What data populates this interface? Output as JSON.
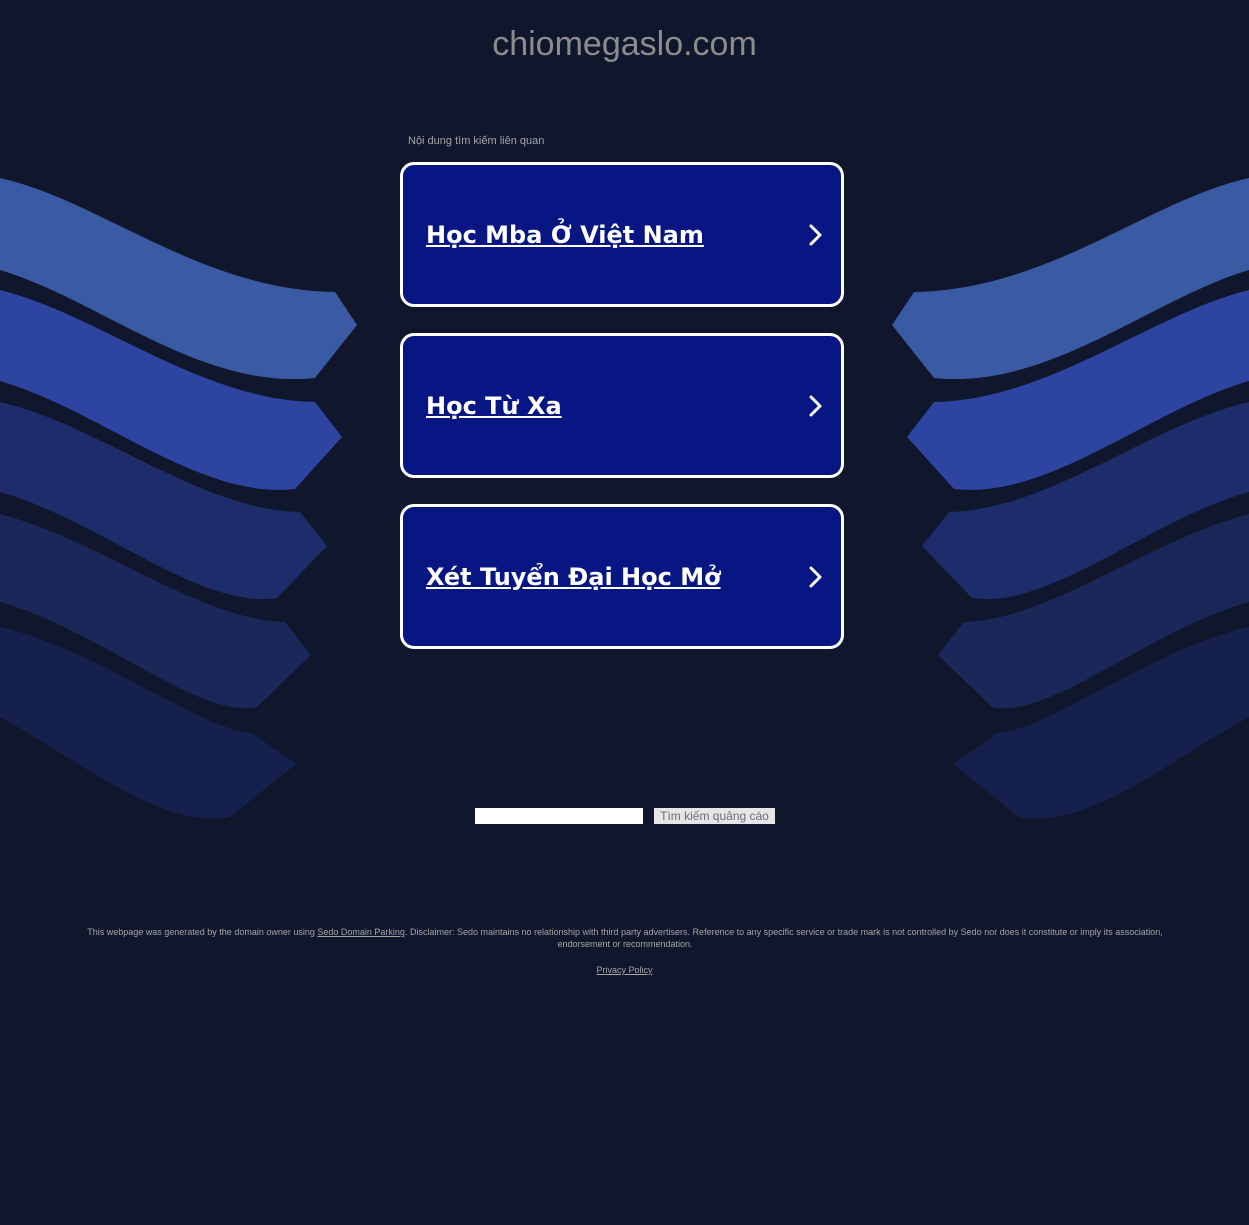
{
  "header": {
    "domain": "chiomegaslo.com"
  },
  "related": {
    "label": "Nội dung tìm kiếm liên quan",
    "links": [
      {
        "label": "Học Mba Ở Việt Nam"
      },
      {
        "label": "Học Từ Xa"
      },
      {
        "label": "Xét Tuyển Đại Học Mở"
      }
    ]
  },
  "search": {
    "value": "",
    "button_label": "Tìm kiếm quảng cáo"
  },
  "footer": {
    "disclaimer_prefix": "This webpage was generated by the domain owner using ",
    "sedo_link": "Sedo Domain Parking",
    "disclaimer_suffix": ". Disclaimer: Sedo maintains no relationship with third party advertisers. Reference to any specific service or trade mark is not controlled by Sedo nor does it constitute or imply its association, endorsement or recommendation.",
    "privacy_link": "Privacy Policy"
  },
  "colors": {
    "background": "#10162b",
    "card": "#081684",
    "wave_light": "#3a5aa3",
    "wave_mid": "#2d44a0",
    "wave_dark": "#1d2d6b",
    "wave_darker": "#1a2758",
    "wave_darkest": "#16204c"
  }
}
